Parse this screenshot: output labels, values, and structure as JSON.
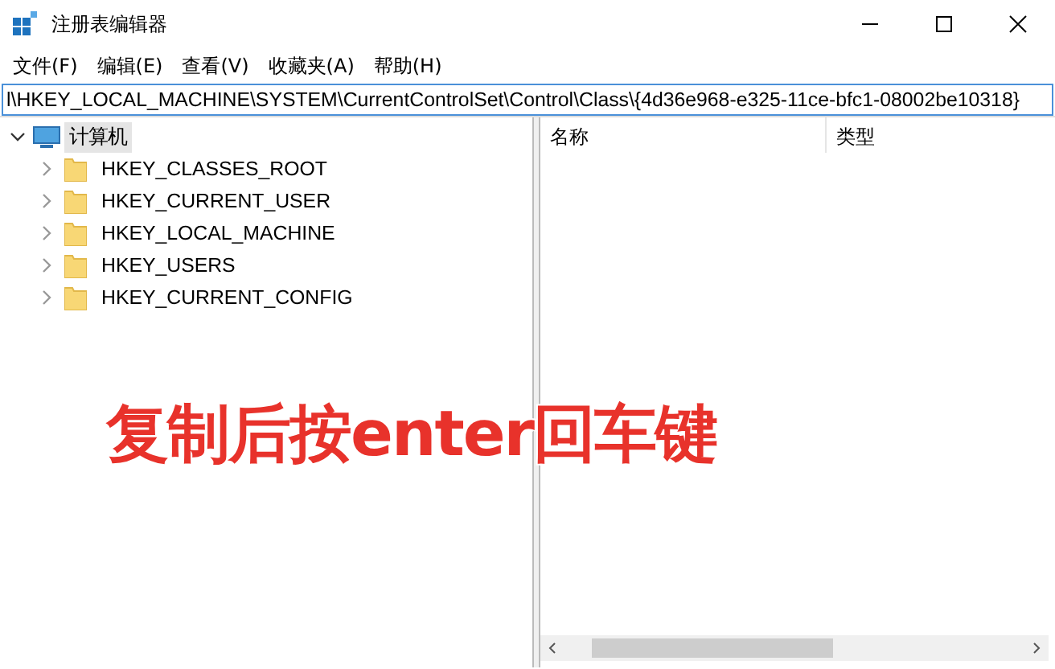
{
  "window": {
    "title": "注册表编辑器"
  },
  "menu": [
    "文件(F)",
    "编辑(E)",
    "查看(V)",
    "收藏夹(A)",
    "帮助(H)"
  ],
  "address": {
    "value": "l\\HKEY_LOCAL_MACHINE\\SYSTEM\\CurrentControlSet\\Control\\Class\\{4d36e968-e325-11ce-bfc1-08002be10318}"
  },
  "tree": [
    {
      "label": "计算机",
      "selected": true,
      "expanded": true,
      "children": [
        {
          "label": "HKEY_CLASSES_ROOT",
          "selected": false,
          "expanded": false
        },
        {
          "label": "HKEY_CURRENT_USER",
          "selected": false,
          "expanded": false
        },
        {
          "label": "HKEY_LOCAL_MACHINE",
          "selected": false,
          "expanded": false
        },
        {
          "label": "HKEY_USERS",
          "selected": false,
          "expanded": false
        },
        {
          "label": "HKEY_CURRENT_CONFIG",
          "selected": false,
          "expanded": false
        }
      ]
    }
  ],
  "list": {
    "columns": [
      "名称",
      "类型"
    ]
  },
  "annotation": {
    "text": "复制后按enter回车键"
  }
}
